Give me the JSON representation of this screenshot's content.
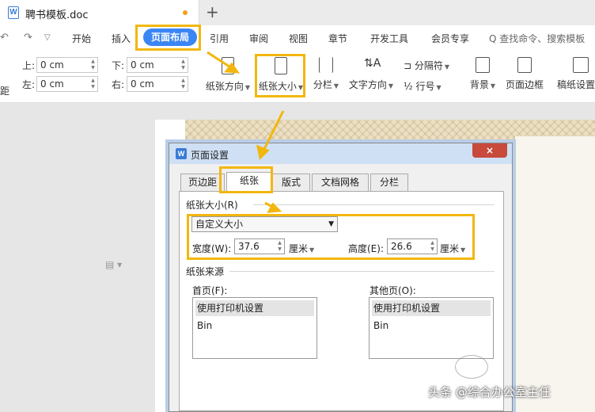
{
  "titlebar": {
    "doc_title": "聘书模板.doc",
    "new_tab": "+"
  },
  "menu": {
    "items": [
      "开始",
      "插入",
      "页面布局",
      "引用",
      "审阅",
      "视图",
      "章节",
      "开发工具",
      "会员专享"
    ],
    "active": "页面布局",
    "search_text": "Q 查找命令、搜索模板"
  },
  "toolbar": {
    "margins": {
      "top_label": "上:",
      "top_value": "0 cm",
      "bottom_label": "下:",
      "bottom_value": "0 cm",
      "left_label": "左:",
      "left_value": "0 cm",
      "right_label": "右:",
      "right_value": "0 cm"
    },
    "paper_direction": "纸张方向",
    "paper_size": "纸张大小",
    "columns": "分栏",
    "text_direction": "文字方向",
    "separator": "分隔符",
    "line_number": "行号",
    "background": "背景",
    "page_border": "页面边框",
    "manuscript": "稿纸设置",
    "left_partial": "距"
  },
  "dialog": {
    "title": "页面设置",
    "close": "×",
    "tabs": [
      "页边距",
      "纸张",
      "版式",
      "文档网格",
      "分栏"
    ],
    "active_tab": "纸张",
    "paper_size_group": "纸张大小(R)",
    "paper_size_value": "自定义大小",
    "width_label": "宽度(W):",
    "width_value": "37.6",
    "height_label": "高度(E):",
    "height_value": "26.6",
    "unit": "厘米",
    "source_group": "纸张来源",
    "first_page_label": "首页(F):",
    "other_pages_label": "其他页(O):",
    "first_page_items": [
      "使用打印机设置",
      "Bin"
    ],
    "other_pages_items": [
      "使用打印机设置",
      "Bin"
    ]
  },
  "watermark": "头条 @综合办公室主任",
  "colors": {
    "accent": "#3b86f5",
    "highlight": "#f2b70e",
    "close": "#c74a3c"
  }
}
